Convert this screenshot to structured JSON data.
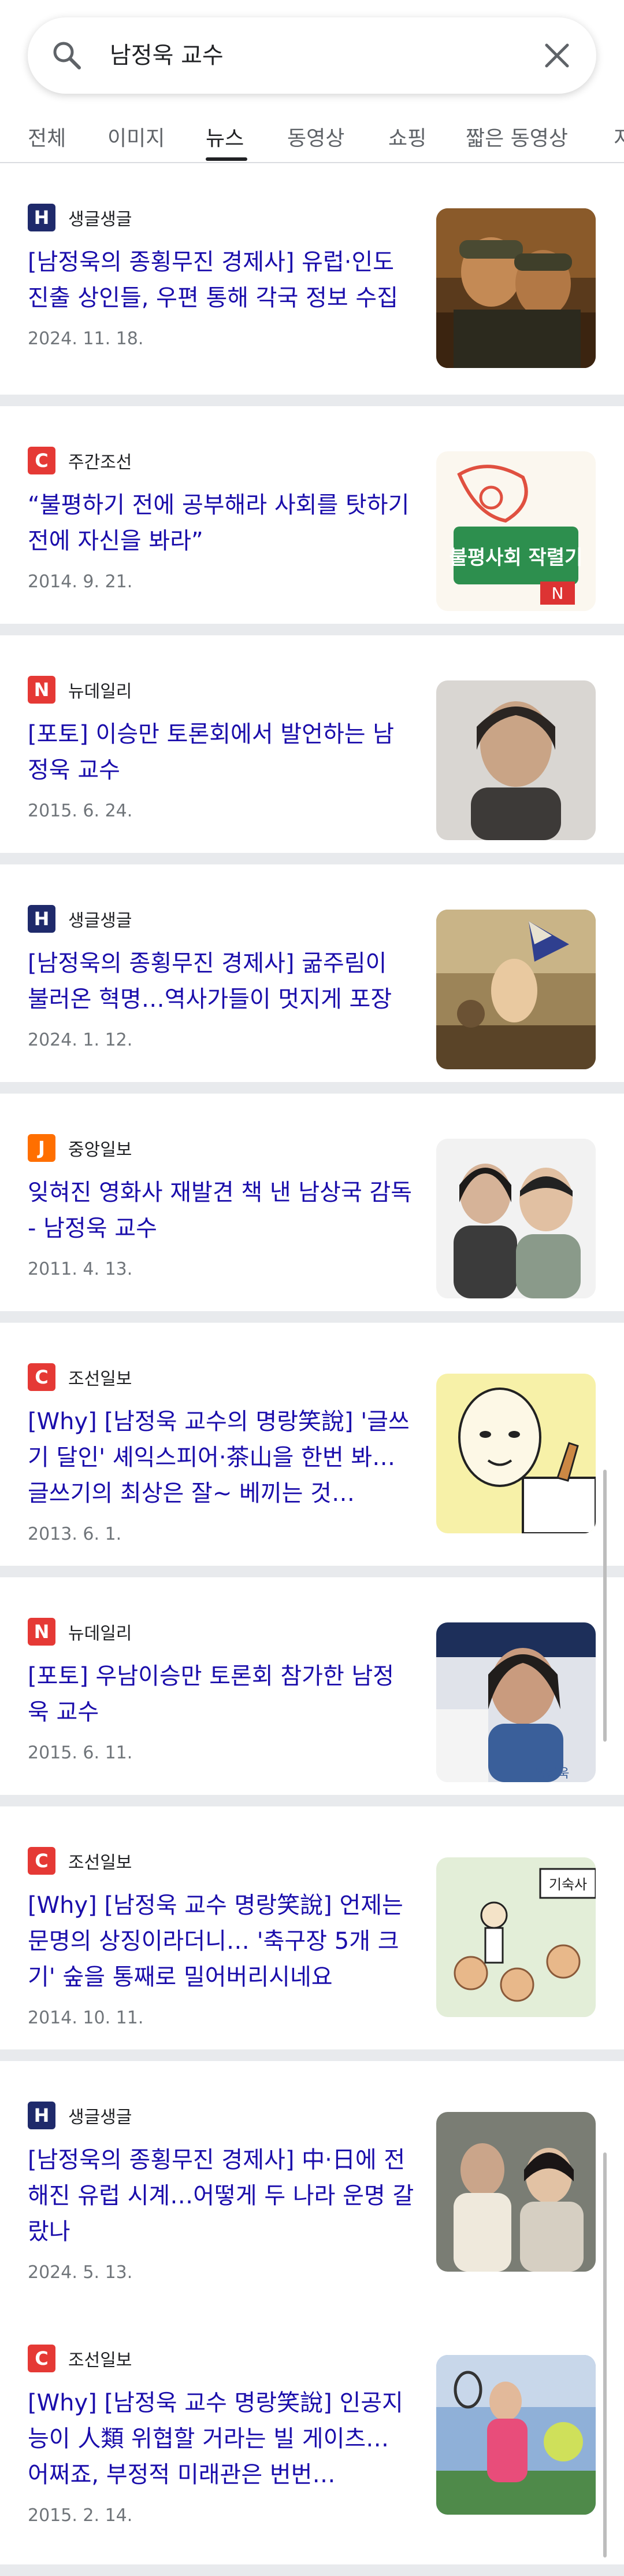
{
  "search": {
    "query": "남정욱 교수"
  },
  "tabs": [
    {
      "label": "전체"
    },
    {
      "label": "이미지"
    },
    {
      "label": "뉴스"
    },
    {
      "label": "동영상"
    },
    {
      "label": "쇼핑"
    },
    {
      "label": "짧은 동영상"
    },
    {
      "label": "지"
    }
  ],
  "active_tab": "뉴스",
  "results": [
    {
      "source": "생글생글",
      "logo_letter": "H",
      "logo_color": "#1f2a6b",
      "title": "[남정욱의 종횡무진 경제사] 유럽·인도 진출 상인들, 우편 통해 각국 정보 수집",
      "date": "2024. 11. 18."
    },
    {
      "source": "주간조선",
      "logo_letter": "C",
      "logo_color": "#e53935",
      "title": "“불평하기 전에 공부해라 사회를 탓하기 전에 자신을 봐라”",
      "date": "2014. 9. 21."
    },
    {
      "source": "뉴데일리",
      "logo_letter": "N",
      "logo_color": "#e53935",
      "title": "[포토] 이승만 토론회에서 발언하는 남정욱 교수",
      "date": "2015. 6. 24."
    },
    {
      "source": "생글생글",
      "logo_letter": "H",
      "logo_color": "#1f2a6b",
      "title": "[남정욱의 종횡무진 경제사] 굶주림이 불러온 혁명…역사가들이 멋지게 포장",
      "date": "2024. 1. 12."
    },
    {
      "source": "중앙일보",
      "logo_letter": "J",
      "logo_color": "#ff6f00",
      "title": "잊혀진 영화사 재발견 책 낸 남상국 감독 - 남정욱 교수",
      "date": "2011. 4. 13."
    },
    {
      "source": "조선일보",
      "logo_letter": "C",
      "logo_color": "#e53935",
      "title": "[Why] [남정욱 교수의 명랑笑說] '글쓰기 달인' 셰익스피어·茶山을 한번 봐… 글쓰기의 최상은 잘~ 베끼는 것…",
      "date": "2013. 6. 1."
    },
    {
      "source": "뉴데일리",
      "logo_letter": "N",
      "logo_color": "#e53935",
      "title": "[포토] 우남이승만 토론회 참가한 남정욱 교수",
      "date": "2015. 6. 11."
    },
    {
      "source": "조선일보",
      "logo_letter": "C",
      "logo_color": "#e53935",
      "title": "[Why] [남정욱 교수 명랑笑說] 언제는 문명의 상징이라더니… '축구장 5개 크기' 숲을 통째로 밀어버리시네요",
      "date": "2014. 10. 11."
    },
    {
      "source": "생글생글",
      "logo_letter": "H",
      "logo_color": "#1f2a6b",
      "title": "[남정욱의 종횡무진 경제사] 中·日에 전해진 유럽 시계…어떻게 두 나라 운명 갈랐나",
      "date": "2024. 5. 13."
    },
    {
      "source": "조선일보",
      "logo_letter": "C",
      "logo_color": "#e53935",
      "title": "[Why] [남정욱 교수 명랑笑說] 인공지능이 人類 위협할 거라는 빌 게이츠… 어쩌죠, 부정적 미래관은 번번…",
      "date": "2015. 2. 14."
    }
  ],
  "thumb_2_text": "불평사회 작렬기",
  "thumb_7_text": "남정욱",
  "thumb_8_text": "기숙사"
}
